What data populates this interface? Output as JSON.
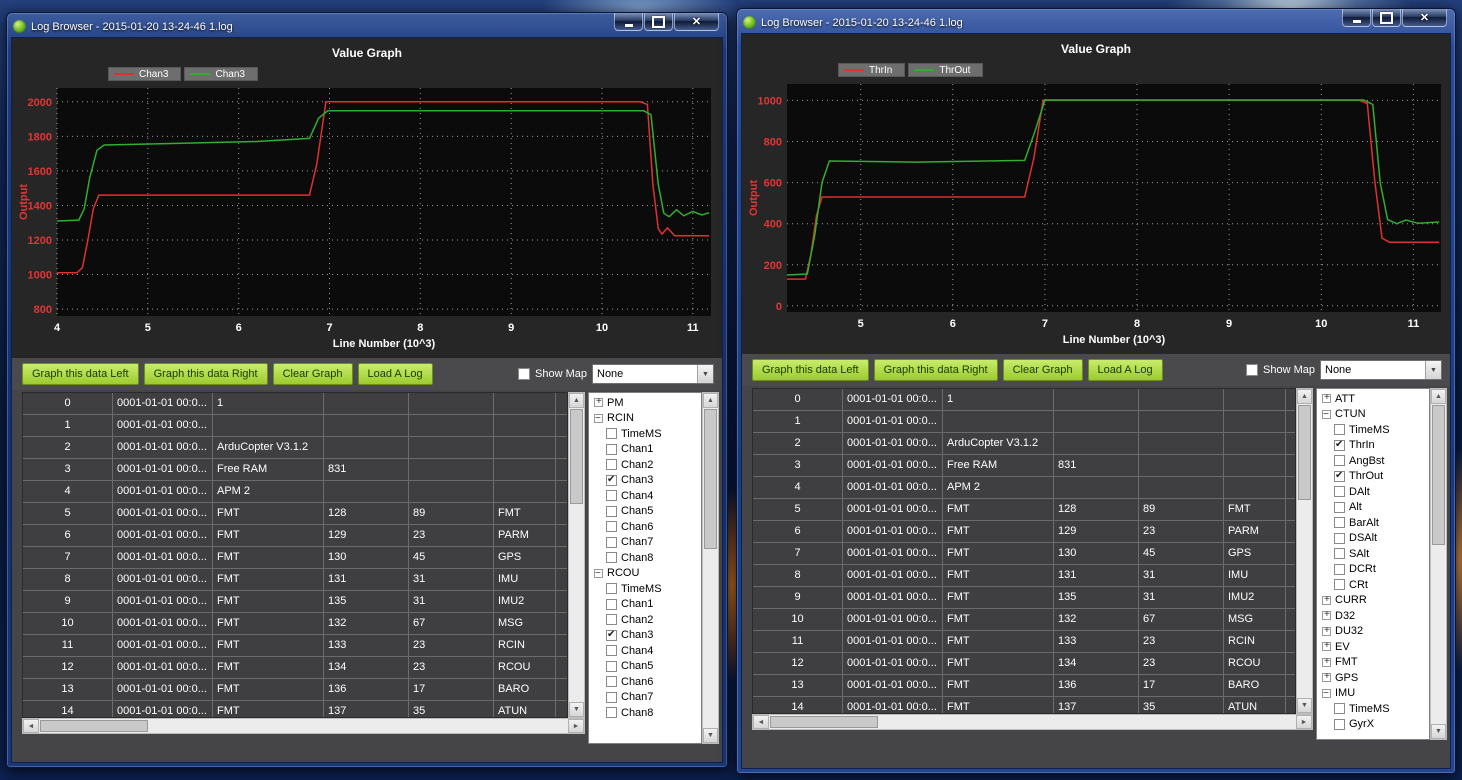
{
  "shared": {
    "buttons": [
      "Graph this data Left",
      "Graph this data Right",
      "Clear Graph",
      "Load A Log"
    ],
    "show_map_label": "Show Map",
    "dropdown_value": "None",
    "icons": {
      "app_icon": "green-orb-icon",
      "minimize": "minimize-bar",
      "maximize": "square",
      "close": "x-cross",
      "dropdown_arrow": "down-triangle",
      "tree_expand": "plus-box",
      "tree_collapse": "minus-box"
    },
    "colors": {
      "series_red": "#e03030",
      "series_green": "#2fae2f",
      "button_green": "#9ccb2e",
      "axis_label_red": "#e33535"
    }
  },
  "windows": [
    {
      "title": "Log Browser - 2015-01-20 13-24-46 1.log",
      "legend": [
        {
          "label": "Chan3",
          "color": "#e03030"
        },
        {
          "label": "Chan3",
          "color": "#2fae2f"
        }
      ],
      "chart_data": {
        "type": "line",
        "title": "Value Graph",
        "xlabel": "Line Number (10^3)",
        "ylabel": "Output",
        "xlim": [
          4,
          11.2
        ],
        "ylim": [
          760,
          2080
        ],
        "xticks": [
          4,
          5,
          6,
          7,
          8,
          9,
          10,
          11
        ],
        "yticks": [
          800,
          1000,
          1200,
          1400,
          1600,
          1800,
          2000
        ],
        "grid": true,
        "legend_position": "top-left",
        "series": [
          {
            "name": "Chan3",
            "color": "#e03030",
            "x": [
              4.0,
              4.22,
              4.28,
              4.34,
              4.4,
              4.46,
              6.78,
              6.86,
              6.96,
              10.42,
              10.5,
              10.56,
              10.62,
              10.66,
              10.72,
              10.8,
              11.18
            ],
            "y": [
              1010,
              1010,
              1040,
              1200,
              1380,
              1460,
              1460,
              1640,
              2000,
              2000,
              1985,
              1520,
              1265,
              1235,
              1270,
              1225,
              1225
            ]
          },
          {
            "name": "Chan3",
            "color": "#2fae2f",
            "x": [
              4.0,
              4.24,
              4.3,
              4.36,
              4.44,
              4.52,
              5.2,
              6.2,
              6.78,
              6.88,
              6.98,
              10.46,
              10.54,
              10.62,
              10.68,
              10.74,
              10.82,
              10.9,
              11.0,
              11.1,
              11.18
            ],
            "y": [
              1310,
              1315,
              1380,
              1560,
              1720,
              1750,
              1758,
              1770,
              1788,
              1905,
              1948,
              1948,
              1925,
              1520,
              1355,
              1335,
              1375,
              1340,
              1365,
              1345,
              1358
            ]
          }
        ]
      },
      "table": {
        "rows": [
          [
            "0",
            "0001-01-01 00:0...",
            "1",
            "",
            "",
            ""
          ],
          [
            "1",
            "0001-01-01 00:0...",
            "",
            "",
            "",
            ""
          ],
          [
            "2",
            "0001-01-01 00:0...",
            "ArduCopter V3.1.2",
            "",
            "",
            ""
          ],
          [
            "3",
            "0001-01-01 00:0...",
            "Free RAM",
            "831",
            "",
            ""
          ],
          [
            "4",
            "0001-01-01 00:0...",
            "APM 2",
            "",
            "",
            ""
          ],
          [
            "5",
            "0001-01-01 00:0...",
            "FMT",
            "128",
            "89",
            "FMT"
          ],
          [
            "6",
            "0001-01-01 00:0...",
            "FMT",
            "129",
            "23",
            "PARM"
          ],
          [
            "7",
            "0001-01-01 00:0...",
            "FMT",
            "130",
            "45",
            "GPS"
          ],
          [
            "8",
            "0001-01-01 00:0...",
            "FMT",
            "131",
            "31",
            "IMU"
          ],
          [
            "9",
            "0001-01-01 00:0...",
            "FMT",
            "135",
            "31",
            "IMU2"
          ],
          [
            "10",
            "0001-01-01 00:0...",
            "FMT",
            "132",
            "67",
            "MSG"
          ],
          [
            "11",
            "0001-01-01 00:0...",
            "FMT",
            "133",
            "23",
            "RCIN"
          ],
          [
            "12",
            "0001-01-01 00:0...",
            "FMT",
            "134",
            "23",
            "RCOU"
          ],
          [
            "13",
            "0001-01-01 00:0...",
            "FMT",
            "136",
            "17",
            "BARO"
          ],
          [
            "14",
            "0001-01-01 00:0...",
            "FMT",
            "137",
            "35",
            "ATUN"
          ]
        ]
      },
      "tree": [
        {
          "label": "PM",
          "expanded": false,
          "children": []
        },
        {
          "label": "RCIN",
          "expanded": true,
          "children": [
            {
              "label": "TimeMS",
              "checked": false
            },
            {
              "label": "Chan1",
              "checked": false
            },
            {
              "label": "Chan2",
              "checked": false
            },
            {
              "label": "Chan3",
              "checked": true
            },
            {
              "label": "Chan4",
              "checked": false
            },
            {
              "label": "Chan5",
              "checked": false
            },
            {
              "label": "Chan6",
              "checked": false
            },
            {
              "label": "Chan7",
              "checked": false
            },
            {
              "label": "Chan8",
              "checked": false
            }
          ]
        },
        {
          "label": "RCOU",
          "expanded": true,
          "children": [
            {
              "label": "TimeMS",
              "checked": false
            },
            {
              "label": "Chan1",
              "checked": false
            },
            {
              "label": "Chan2",
              "checked": false
            },
            {
              "label": "Chan3",
              "checked": true
            },
            {
              "label": "Chan4",
              "checked": false
            },
            {
              "label": "Chan5",
              "checked": false
            },
            {
              "label": "Chan6",
              "checked": false
            },
            {
              "label": "Chan7",
              "checked": false
            },
            {
              "label": "Chan8",
              "checked": false
            }
          ]
        }
      ]
    },
    {
      "title": "Log Browser - 2015-01-20 13-24-46 1.log",
      "legend": [
        {
          "label": "ThrIn",
          "color": "#e03030"
        },
        {
          "label": "ThrOut",
          "color": "#2fae2f"
        }
      ],
      "chart_data": {
        "type": "line",
        "title": "Value Graph",
        "xlabel": "Line Number (10^3)",
        "ylabel": "Output",
        "xlim": [
          4.2,
          11.3
        ],
        "ylim": [
          -30,
          1080
        ],
        "xticks": [
          5,
          6,
          7,
          8,
          9,
          10,
          11
        ],
        "yticks": [
          0,
          200,
          400,
          600,
          800,
          1000
        ],
        "grid": true,
        "legend_position": "top-left",
        "series": [
          {
            "name": "ThrIn",
            "color": "#e03030",
            "x": [
              4.2,
              4.4,
              4.46,
              4.52,
              4.58,
              6.78,
              6.88,
              6.98,
              10.42,
              10.5,
              10.58,
              10.66,
              10.74,
              11.28
            ],
            "y": [
              130,
              130,
              250,
              440,
              530,
              530,
              720,
              1000,
              1000,
              985,
              610,
              330,
              310,
              310
            ]
          },
          {
            "name": "ThrOut",
            "color": "#2fae2f",
            "x": [
              4.2,
              4.42,
              4.5,
              4.58,
              4.66,
              5.6,
              6.78,
              6.9,
              7.0,
              10.46,
              10.56,
              10.64,
              10.72,
              10.82,
              10.92,
              11.05,
              11.28
            ],
            "y": [
              150,
              155,
              340,
              600,
              705,
              700,
              708,
              860,
              1002,
              1002,
              980,
              600,
              420,
              400,
              418,
              402,
              408
            ]
          }
        ]
      },
      "table": {
        "rows": [
          [
            "0",
            "0001-01-01 00:0...",
            "1",
            "",
            "",
            ""
          ],
          [
            "1",
            "0001-01-01 00:0...",
            "",
            "",
            "",
            ""
          ],
          [
            "2",
            "0001-01-01 00:0...",
            "ArduCopter V3.1.2",
            "",
            "",
            ""
          ],
          [
            "3",
            "0001-01-01 00:0...",
            "Free RAM",
            "831",
            "",
            ""
          ],
          [
            "4",
            "0001-01-01 00:0...",
            "APM 2",
            "",
            "",
            ""
          ],
          [
            "5",
            "0001-01-01 00:0...",
            "FMT",
            "128",
            "89",
            "FMT"
          ],
          [
            "6",
            "0001-01-01 00:0...",
            "FMT",
            "129",
            "23",
            "PARM"
          ],
          [
            "7",
            "0001-01-01 00:0...",
            "FMT",
            "130",
            "45",
            "GPS"
          ],
          [
            "8",
            "0001-01-01 00:0...",
            "FMT",
            "131",
            "31",
            "IMU"
          ],
          [
            "9",
            "0001-01-01 00:0...",
            "FMT",
            "135",
            "31",
            "IMU2"
          ],
          [
            "10",
            "0001-01-01 00:0...",
            "FMT",
            "132",
            "67",
            "MSG"
          ],
          [
            "11",
            "0001-01-01 00:0...",
            "FMT",
            "133",
            "23",
            "RCIN"
          ],
          [
            "12",
            "0001-01-01 00:0...",
            "FMT",
            "134",
            "23",
            "RCOU"
          ],
          [
            "13",
            "0001-01-01 00:0...",
            "FMT",
            "136",
            "17",
            "BARO"
          ],
          [
            "14",
            "0001-01-01 00:0...",
            "FMT",
            "137",
            "35",
            "ATUN"
          ]
        ]
      },
      "tree": [
        {
          "label": "ATT",
          "expanded": false,
          "children": []
        },
        {
          "label": "CTUN",
          "expanded": true,
          "children": [
            {
              "label": "TimeMS",
              "checked": false
            },
            {
              "label": "ThrIn",
              "checked": true
            },
            {
              "label": "AngBst",
              "checked": false
            },
            {
              "label": "ThrOut",
              "checked": true
            },
            {
              "label": "DAlt",
              "checked": false
            },
            {
              "label": "Alt",
              "checked": false
            },
            {
              "label": "BarAlt",
              "checked": false
            },
            {
              "label": "DSAlt",
              "checked": false
            },
            {
              "label": "SAlt",
              "checked": false
            },
            {
              "label": "DCRt",
              "checked": false
            },
            {
              "label": "CRt",
              "checked": false
            }
          ]
        },
        {
          "label": "CURR",
          "expanded": false,
          "children": []
        },
        {
          "label": "D32",
          "expanded": false,
          "children": []
        },
        {
          "label": "DU32",
          "expanded": false,
          "children": []
        },
        {
          "label": "EV",
          "expanded": false,
          "children": []
        },
        {
          "label": "FMT",
          "expanded": false,
          "children": []
        },
        {
          "label": "GPS",
          "expanded": false,
          "children": []
        },
        {
          "label": "IMU",
          "expanded": true,
          "children": [
            {
              "label": "TimeMS",
              "checked": false
            },
            {
              "label": "GyrX",
              "checked": false
            }
          ]
        }
      ]
    }
  ]
}
